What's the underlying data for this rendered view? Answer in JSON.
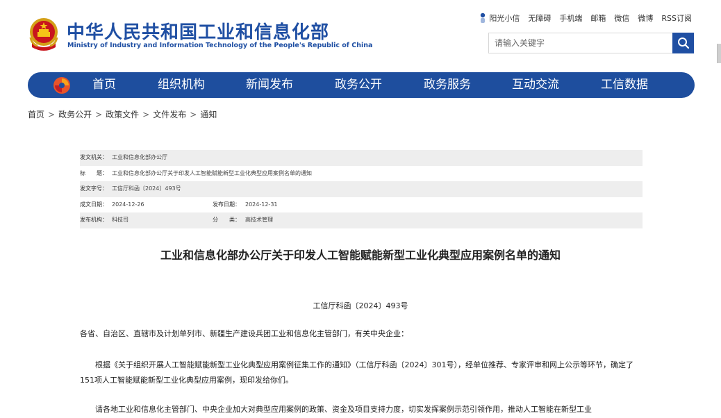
{
  "header": {
    "title_cn": "中华人民共和国工业和信息化部",
    "title_en": "Ministry of Industry and Information Technology of the People's Republic of China",
    "emblem_icon": "national-emblem-icon",
    "top_links": [
      "阳光小信",
      "无障碍",
      "手机端",
      "邮箱",
      "微信",
      "微博",
      "RSS订阅"
    ],
    "search_placeholder": "请输入关键字",
    "brand_color": "#1f4fa3"
  },
  "nav": {
    "items": [
      "首页",
      "组织机构",
      "新闻发布",
      "政务公开",
      "政务服务",
      "互动交流",
      "工信数据"
    ],
    "color": "#1e4e9e"
  },
  "breadcrumb": [
    "首页",
    "政务公开",
    "政策文件",
    "文件发布",
    "通知"
  ],
  "breadcrumb_sep": ">",
  "meta": {
    "issuer_label": "发文机关：",
    "issuer": "工业和信息化部办公厅",
    "title_label": "标　　题：",
    "title": "工业和信息化部办公厅关于印发人工智能赋能新型工业化典型应用案例名单的通知",
    "doc_no_label": "发文字号：",
    "doc_no": "工信厅科函〔2024〕493号",
    "created_label": "成文日期：",
    "created": "2024-12-26",
    "published_label": "发布日期：",
    "published": "2024-12-31",
    "agency_label": "发布机构：",
    "agency": "科技司",
    "category_label": "分　　类：",
    "category": "高技术管理"
  },
  "article": {
    "title": "工业和信息化部办公厅关于印发人工智能赋能新型工业化典型应用案例名单的通知",
    "doc_no": "工信厅科函〔2024〕493号",
    "p1": "各省、自治区、直辖市及计划单列市、新疆生产建设兵团工业和信息化主管部门，有关中央企业：",
    "p2": "根据《关于组织开展人工智能赋能新型工业化典型应用案例征集工作的通知》（工信厅科函〔2024〕301号），经单位推荐、专家评审和网上公示等环节，确定了151项人工智能赋能新型工业化典型应用案例，现印发给你们。",
    "p3": "请各地工业和信息化主管部门、中央企业加大对典型应用案例的政策、资金及项目支持力度，切实发挥案例示范引领作用，推动人工智能在新型工业"
  }
}
